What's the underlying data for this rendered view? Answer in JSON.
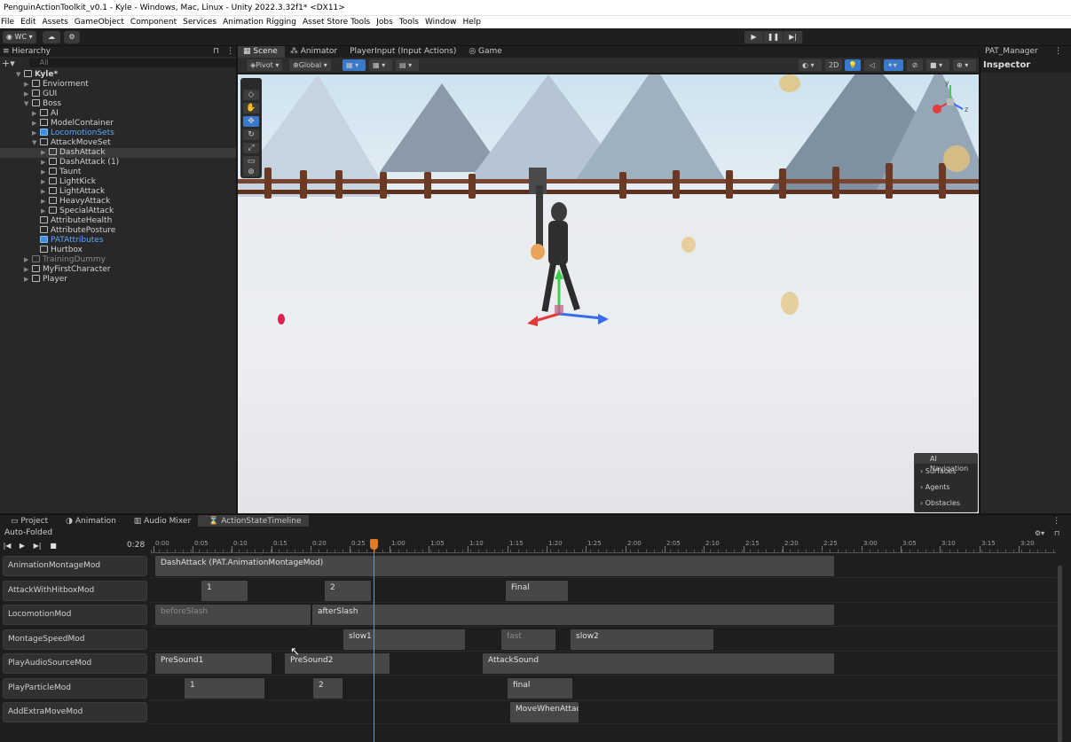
{
  "window": {
    "title": "PenguinActionToolkit_v0.1 - Kyle - Windows, Mac, Linux - Unity 2022.3.32f1* <DX11>"
  },
  "menu": [
    "File",
    "Edit",
    "Assets",
    "GameObject",
    "Component",
    "Services",
    "Animation Rigging",
    "Asset Store Tools",
    "Jobs",
    "Tools",
    "Window",
    "Help"
  ],
  "toolbar": {
    "account": "WC ▾"
  },
  "hierarchy": {
    "title": "Hierarchy",
    "search_placeholder": "All",
    "items": [
      {
        "label": "Kyle*"
      },
      {
        "label": "Enviorment"
      },
      {
        "label": "GUI"
      },
      {
        "label": "Boss"
      },
      {
        "label": "AI"
      },
      {
        "label": "ModelContainer"
      },
      {
        "label": "LocomotionSets"
      },
      {
        "label": "AttackMoveSet"
      },
      {
        "label": "DashAttack"
      },
      {
        "label": "DashAttack (1)"
      },
      {
        "label": "Taunt"
      },
      {
        "label": "LightKick"
      },
      {
        "label": "LightAttack"
      },
      {
        "label": "HeavyAttack"
      },
      {
        "label": "SpecialAttack"
      },
      {
        "label": "AttributeHealth"
      },
      {
        "label": "AttributePosture"
      },
      {
        "label": "PATAttributes"
      },
      {
        "label": "Hurtbox"
      },
      {
        "label": "TrainingDummy"
      },
      {
        "label": "MyFirstCharacter"
      },
      {
        "label": "Player"
      }
    ]
  },
  "scene": {
    "tabs": [
      "Scene",
      "Animator",
      "PlayerInput (Input Actions)",
      "Game"
    ],
    "pivot": "Pivot",
    "global": "Global",
    "mode_2d": "2D",
    "ai_navigation": {
      "title": "AI Navigation",
      "items": [
        "Surfaces",
        "Agents",
        "Obstacles"
      ]
    }
  },
  "right_panel": {
    "tab": "PAT_Manager",
    "inspector": "Inspector"
  },
  "bottom": {
    "tabs": [
      "Project",
      "Animation",
      "Audio Mixer",
      "ActionStateTimeline"
    ],
    "auto_folded": "Auto-Folded",
    "current_time": "0:28",
    "ticks": [
      "0:00",
      "0:05",
      "0:10",
      "0:15",
      "0:20",
      "0:25",
      "1:00",
      "1:05",
      "1:10",
      "1:15",
      "1:20",
      "1:25",
      "2:00",
      "2:05",
      "2:10",
      "2:15",
      "2:20",
      "2:25",
      "3:00",
      "3:05",
      "3:10",
      "3:15",
      "3:20"
    ],
    "tracks": [
      {
        "label": "AnimationMontageMod",
        "clips": [
          "DashAttack (PAT.AnimationMontageMod)"
        ]
      },
      {
        "label": "AttackWithHitboxMod",
        "clips": [
          "1",
          "2",
          "Final"
        ]
      },
      {
        "label": "LocomotionMod",
        "clips": [
          "beforeSlash",
          "afterSlash"
        ]
      },
      {
        "label": "MontageSpeedMod",
        "clips": [
          "slow1",
          "fast",
          "slow2"
        ]
      },
      {
        "label": "PlayAudioSourceMod",
        "clips": [
          "PreSound1",
          "PreSound2",
          "AttackSound"
        ]
      },
      {
        "label": "PlayParticleMod",
        "clips": [
          "1",
          "2",
          "final"
        ]
      },
      {
        "label": "AddExtraMoveMod",
        "clips": [
          "MoveWhenAttack"
        ]
      }
    ]
  }
}
